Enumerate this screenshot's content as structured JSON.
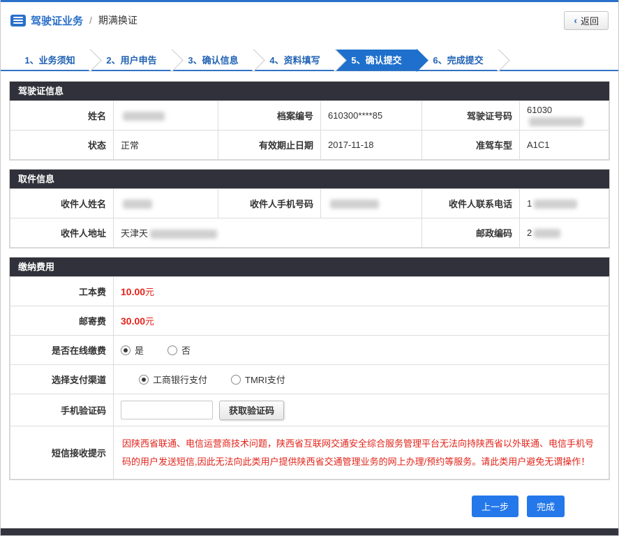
{
  "header": {
    "title": "驾驶证业务",
    "divider": "/",
    "subtitle": "期满换证",
    "back_icon": "‹",
    "back_label": "返回"
  },
  "steps": [
    "1、业务须知",
    "2、用户申告",
    "3、确认信息",
    "4、资料填写",
    "5、确认提交",
    "6、完成提交"
  ],
  "active_step": "5、确认提交",
  "license": {
    "title": "驾驶证信息",
    "name_label": "姓名",
    "name_value": "",
    "file_number_label": "档案编号",
    "file_number_value": "610300****85",
    "license_number_label": "驾驶证号码",
    "license_number_value": "61030",
    "status_label": "状态",
    "status_value": "正常",
    "expiry_label": "有效期止日期",
    "expiry_value": "2017-11-18",
    "vehicle_class_label": "准驾车型",
    "vehicle_class_value": "A1C1"
  },
  "pickup": {
    "title": "取件信息",
    "recipient_name_label": "收件人姓名",
    "recipient_name_value": "",
    "recipient_mobile_label": "收件人手机号码",
    "recipient_mobile_value": "",
    "recipient_phone_label": "收件人联系电话",
    "recipient_phone_value": "1",
    "address_label": "收件人地址",
    "address_value": "天津天",
    "postcode_label": "邮政编码",
    "postcode_value": "2"
  },
  "fees": {
    "title": "缴纳费用",
    "production_fee_label": "工本费",
    "production_fee_value": "10.00",
    "mailing_fee_label": "邮寄费",
    "mailing_fee_value": "30.00",
    "currency": "元",
    "online_payment_label": "是否在线缴费",
    "online_yes": "是",
    "online_no": "否",
    "channel_label": "选择支付渠道",
    "channel_icbc": "工商银行支付",
    "channel_tmri": "TMRI支付",
    "sms_code_label": "手机验证码",
    "sms_code_value": "",
    "get_code_button": "获取验证码",
    "sms_notice_label": "短信接收提示",
    "sms_notice_text": "因陕西省联通、电信运营商技术问题，陕西省互联网交通安全综合服务管理平台无法向持陕西省以外联通、电信手机号码的用户发送短信,因此无法向此类用户提供陕西省交通管理业务的网上办理/预约等服务。请此类用户避免无谓操作！"
  },
  "actions": {
    "previous": "上一步",
    "finish": "完成"
  },
  "colors": {
    "accent_blue": "#2a6fc9",
    "active_step_bg": "#1e70cc",
    "section_header_bg": "#30313a",
    "fee_red": "#e2231a",
    "button_blue": "#2478ea",
    "label_cell_bg": "#ececec"
  },
  "icons": {
    "header_badge": "form-icon",
    "back": "chevron-left",
    "radio_checked": "filled-circle",
    "radio_unchecked": "empty-circle"
  }
}
